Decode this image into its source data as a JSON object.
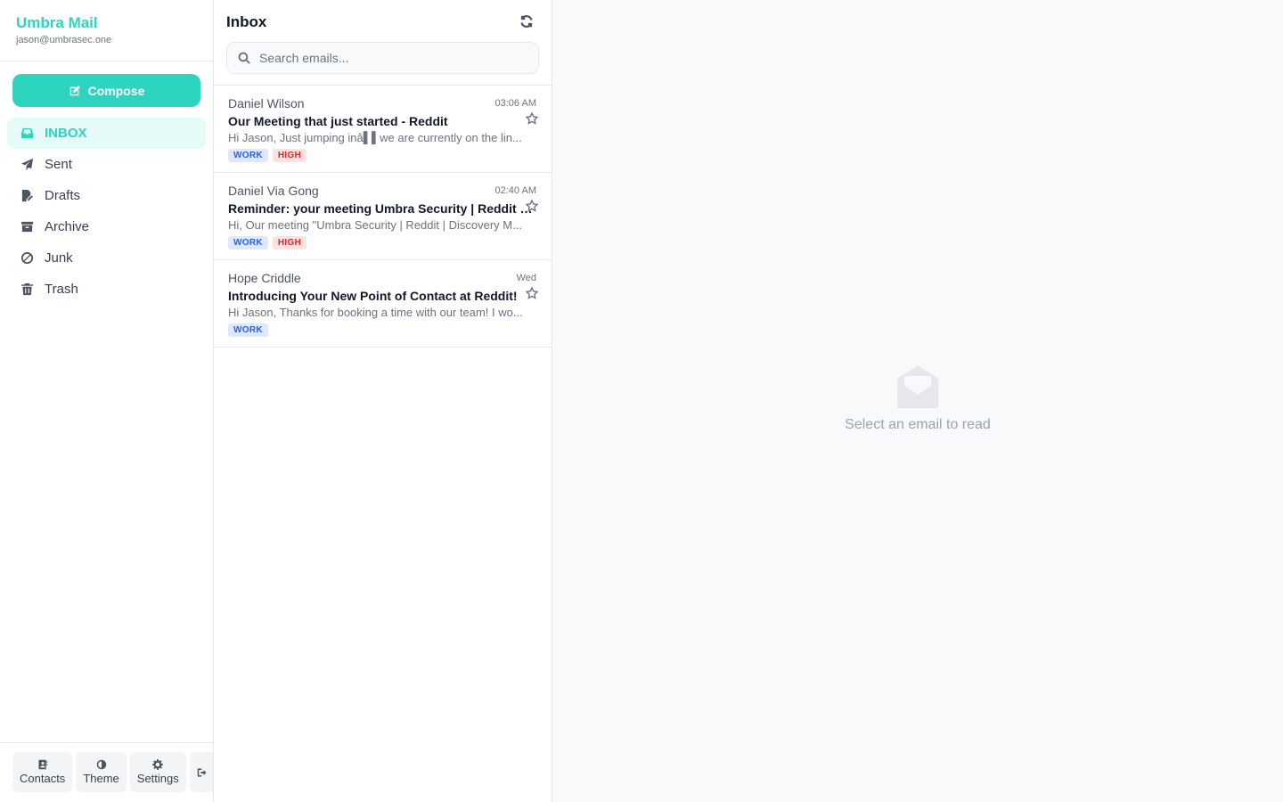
{
  "app": {
    "name": "Umbra Mail",
    "account_email": "jason@umbrasec.one",
    "accent_color": "#2dd4bf"
  },
  "sidebar": {
    "compose_label": "Compose",
    "items": [
      {
        "label": "INBOX",
        "icon": "inbox-icon",
        "active": true
      },
      {
        "label": "Sent",
        "icon": "paper-plane-icon",
        "active": false
      },
      {
        "label": "Drafts",
        "icon": "file-pen-icon",
        "active": false
      },
      {
        "label": "Archive",
        "icon": "archive-box-icon",
        "active": false
      },
      {
        "label": "Junk",
        "icon": "ban-icon",
        "active": false
      },
      {
        "label": "Trash",
        "icon": "trash-icon",
        "active": false
      }
    ],
    "footer": {
      "contacts_label": "Contacts",
      "theme_label": "Theme",
      "settings_label": "Settings",
      "logout_icon": "sign-out-icon"
    }
  },
  "mail_list": {
    "title": "Inbox",
    "refresh_icon": "refresh-icon",
    "search_placeholder": "Search emails...",
    "emails": [
      {
        "from": "Daniel Wilson",
        "time": "03:06 AM",
        "subject": "Our Meeting that just started - Reddit",
        "preview": "Hi Jason, Just jumping inâ▌▌we are currently on the lin...",
        "tags": [
          "WORK",
          "HIGH"
        ],
        "starred": false
      },
      {
        "from": "Daniel Via Gong",
        "time": "02:40 AM",
        "subject": "Reminder: your meeting Umbra Security | Reddit | Discovery Meeting",
        "preview": "Hi, Our meeting \"Umbra Security | Reddit | Discovery M...",
        "tags": [
          "WORK",
          "HIGH"
        ],
        "starred": false
      },
      {
        "from": "Hope Criddle",
        "time": "Wed",
        "subject": "Introducing Your New Point of Contact at Reddit!",
        "preview": "Hi Jason, Thanks for booking a time with our team! I wo...",
        "tags": [
          "WORK"
        ],
        "starred": false
      }
    ]
  },
  "reader": {
    "empty_icon": "open-envelope-icon",
    "empty_text": "Select an email to read"
  }
}
